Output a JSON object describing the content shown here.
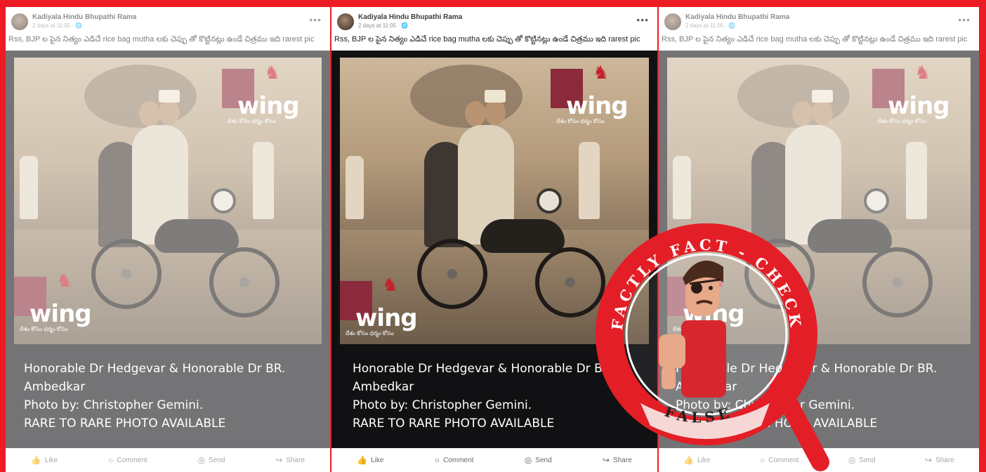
{
  "posts": [
    {
      "author": "Kadiyala Hindu Bhupathi Rama",
      "meta": "2 days at 11:05 · 🌐",
      "menu": "•••",
      "caption": "Rss, BJP ల పైన నిత్యం ఎడిచే rice bag mutha లకు చెప్పు తో కొట్టినట్లు ఉండే చిత్రము ఇది rarest pic",
      "overlay": [
        "Honorable Dr Hedgevar & Honorable Dr BR.",
        "Ambedkar",
        "Photo by: Christopher Gemini.",
        "RARE TO RARE PHOTO AVAILABLE"
      ],
      "logo_word": "wing",
      "logo_tag": "దేశం కోసం ధర్మం కోసం"
    },
    {
      "author": "Kadiyala Hindu Bhupathi Rama",
      "meta": "2 days at 11:05 · 🌐",
      "menu": "•••",
      "caption": "Rss, BJP ల పైన నిత్యం ఎడిచే rice bag mutha లకు చెప్పు తో కొట్టినట్లు ఉండే చిత్రము ఇది rarest pic",
      "overlay": [
        "Honorable Dr Hedgevar & Honorable Dr BR.",
        "Ambedkar",
        "Photo by: Christopher Gemini.",
        "RARE TO RARE PHOTO AVAILABLE"
      ],
      "logo_word": "wing",
      "logo_tag": "దేశం కోసం ధర్మం కోసం"
    },
    {
      "author": "Kadiyala Hindu Bhupathi Rama",
      "meta": "2 days at 11:05 · 🌐",
      "menu": "•••",
      "caption": "Rss, BJP ల పైన నిత్యం ఎడిచే rice bag mutha లకు చెప్పు తో కొట్టినట్లు ఉండే చిత్రము ఇది rarest pic",
      "overlay": [
        "Honorable Dr Hedgevar & Honorable Dr BR.",
        "Ambedkar",
        "Photo by: Christopher Gemini.",
        "RARE TO RARE PHOTO AVAILABLE"
      ],
      "logo_word": "wing",
      "logo_tag": "దేశం కోసం ధర్మం కోసం"
    }
  ],
  "actions": {
    "like": "Like",
    "comment": "Comment",
    "send": "Send",
    "share": "Share"
  },
  "icons": {
    "like": "thumbs-up-icon",
    "comment": "speech-bubble-icon",
    "send": "messenger-icon",
    "share": "share-arrow-icon"
  },
  "stamp": {
    "arc_text": "FACTLY FACT - CHECK",
    "verdict": "FALSE"
  },
  "colors": {
    "frame": "#ed1c24",
    "stamp_red": "#e41e26",
    "text_dark": "#1c1e21",
    "muted": "#65676b"
  }
}
